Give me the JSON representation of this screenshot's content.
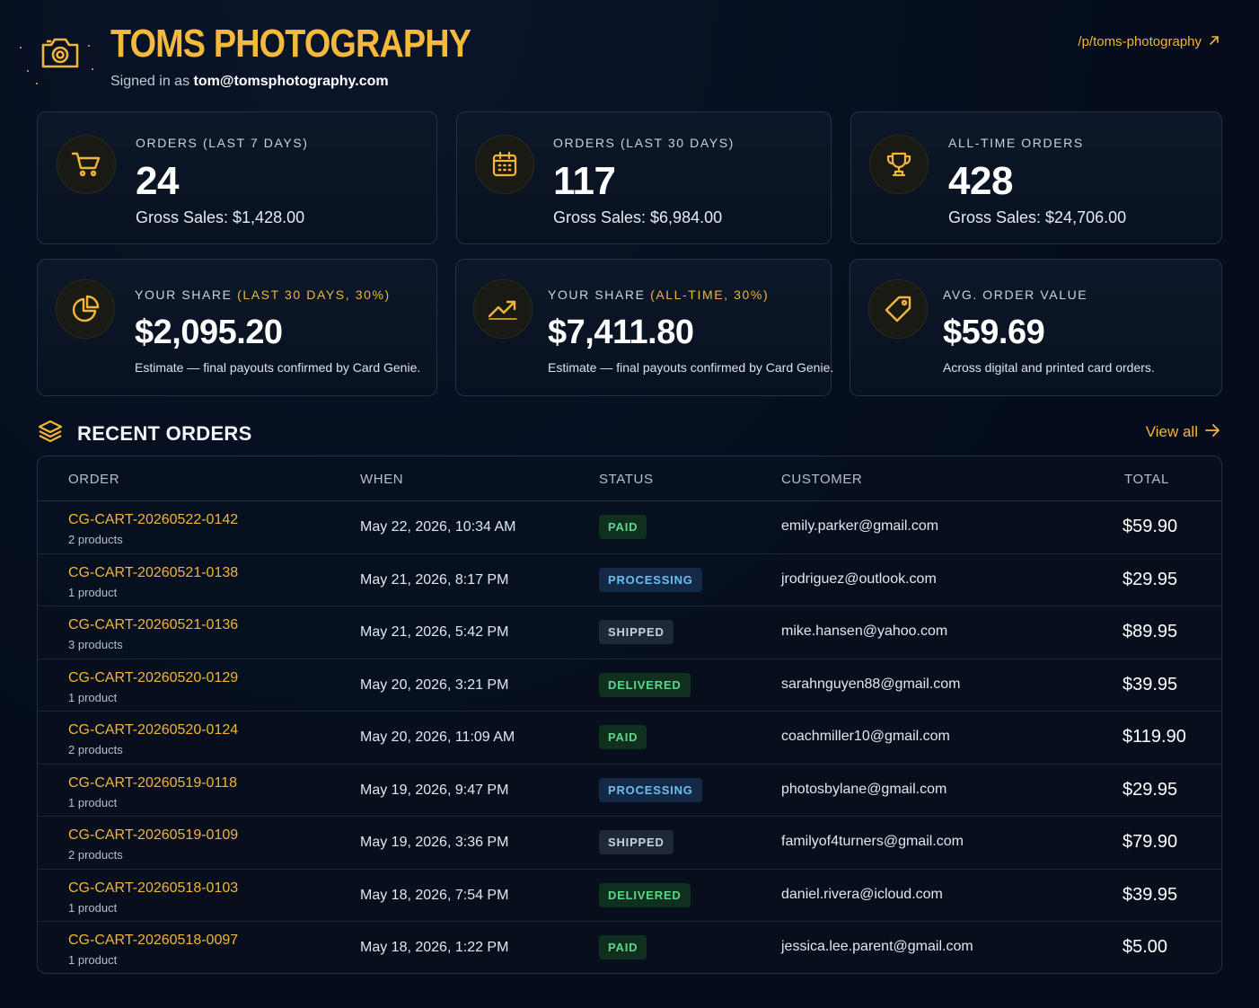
{
  "header": {
    "brand": "TOMS PHOTOGRAPHY",
    "signed_in_prefix": "Signed in as",
    "signed_in_email": "tom@tomsphotography.com",
    "profile_link": "/p/toms-photography",
    "logo_icon": "camera-icon",
    "link_icon": "arrow-up-right-icon"
  },
  "stats": [
    {
      "icon": "cart-icon",
      "label": "ORDERS (LAST 7 DAYS)",
      "value": "24",
      "sub": "Gross Sales: $1,428.00"
    },
    {
      "icon": "calendar-icon",
      "label": "ORDERS (LAST 30 DAYS)",
      "value": "117",
      "sub": "Gross Sales: $6,984.00"
    },
    {
      "icon": "trophy-icon",
      "label": "ALL-TIME ORDERS",
      "value": "428",
      "sub": "Gross Sales: $24,706.00"
    },
    {
      "icon": "pie-chart-icon",
      "label": "YOUR SHARE",
      "label_accent": "(LAST 30 DAYS, 30%)",
      "value": "$2,095.20",
      "sub": "Estimate — final payouts confirmed by Card Genie."
    },
    {
      "icon": "trending-up-icon",
      "label": "YOUR SHARE",
      "label_accent": "(ALL-TIME, 30%)",
      "value": "$7,411.80",
      "sub": "Estimate — final payouts confirmed by Card Genie."
    },
    {
      "icon": "tag-icon",
      "label": "AVG. ORDER VALUE",
      "value": "$59.69",
      "sub": "Across digital and printed card orders."
    }
  ],
  "recent": {
    "title": "RECENT ORDERS",
    "icon": "layers-icon",
    "view_all": "View all",
    "view_all_icon": "arrow-right-icon",
    "columns": [
      "ORDER",
      "WHEN",
      "STATUS",
      "CUSTOMER",
      "TOTAL"
    ],
    "rows": [
      {
        "id": "CG-CART-20260522-0142",
        "products": "2 products",
        "when": "May 22, 2026, 10:34 AM",
        "status": "PAID",
        "status_kind": "paid",
        "customer": "emily.parker@gmail.com",
        "total": "$59.90"
      },
      {
        "id": "CG-CART-20260521-0138",
        "products": "1 product",
        "when": "May 21, 2026, 8:17 PM",
        "status": "PROCESSING",
        "status_kind": "processing",
        "customer": "jrodriguez@outlook.com",
        "total": "$29.95"
      },
      {
        "id": "CG-CART-20260521-0136",
        "products": "3 products",
        "when": "May 21, 2026, 5:42 PM",
        "status": "SHIPPED",
        "status_kind": "shipped",
        "customer": "mike.hansen@yahoo.com",
        "total": "$89.95"
      },
      {
        "id": "CG-CART-20260520-0129",
        "products": "1 product",
        "when": "May 20, 2026, 3:21 PM",
        "status": "DELIVERED",
        "status_kind": "delivered",
        "customer": "sarahnguyen88@gmail.com",
        "total": "$39.95"
      },
      {
        "id": "CG-CART-20260520-0124",
        "products": "2 products",
        "when": "May 20, 2026, 11:09 AM",
        "status": "PAID",
        "status_kind": "paid",
        "customer": "coachmiller10@gmail.com",
        "total": "$119.90"
      },
      {
        "id": "CG-CART-20260519-0118",
        "products": "1 product",
        "when": "May 19, 2026, 9:47 PM",
        "status": "PROCESSING",
        "status_kind": "processing",
        "customer": "photosbylane@gmail.com",
        "total": "$29.95"
      },
      {
        "id": "CG-CART-20260519-0109",
        "products": "2 products",
        "when": "May 19, 2026, 3:36 PM",
        "status": "SHIPPED",
        "status_kind": "shipped",
        "customer": "familyof4turners@gmail.com",
        "total": "$79.90"
      },
      {
        "id": "CG-CART-20260518-0103",
        "products": "1 product",
        "when": "May 18, 2026, 7:54 PM",
        "status": "DELIVERED",
        "status_kind": "delivered",
        "customer": "daniel.rivera@icloud.com",
        "total": "$39.95"
      },
      {
        "id": "CG-CART-20260518-0097",
        "products": "1 product",
        "when": "May 18, 2026, 1:22 PM",
        "status": "PAID",
        "status_kind": "paid",
        "customer": "jessica.lee.parent@gmail.com",
        "total": "$5.00"
      }
    ]
  },
  "colors": {
    "accent": "#f2b53a",
    "background": "#050d1c",
    "paid": "#5ed68a",
    "processing": "#6cbef2",
    "shipped": "#c9d0db"
  }
}
